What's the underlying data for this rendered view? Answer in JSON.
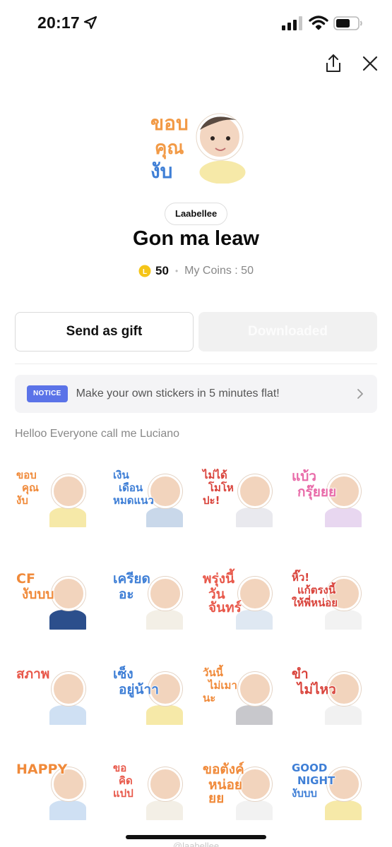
{
  "status_bar": {
    "time": "20:17",
    "icons": [
      "location-arrow-icon",
      "signal-icon",
      "wifi-icon",
      "battery-icon"
    ]
  },
  "top_actions": {
    "icons": [
      "share-icon",
      "close-icon"
    ]
  },
  "package": {
    "hero_sticker_text": [
      "ขอบ",
      "คุณ",
      "งับ"
    ],
    "author": "Laabellee",
    "title": "Gon ma leaw",
    "coin_badge": "L",
    "price": "50",
    "my_coins": "My Coins : 50",
    "description": "Helloo Everyone call me Luciano"
  },
  "buttons": {
    "gift": "Send as gift",
    "downloaded": "Downloaded"
  },
  "notice": {
    "badge": "NOTICE",
    "text": "Make your own stickers in 5 minutes flat!"
  },
  "stickers": [
    {
      "text": "ขอบ คุณ งับ",
      "color": "#f08a3a"
    },
    {
      "text": "เงิน เดือน หมดแนว",
      "color": "#3f7fd6"
    },
    {
      "text": "ไม่ได้ โมโห ปะ!",
      "color": "#d9433b"
    },
    {
      "text": "แบ้ว กรุ๊ยยย",
      "color": "#e86aa8"
    },
    {
      "text": "CF งับบบ",
      "color": "#f08a3a"
    },
    {
      "text": "เครียด อะ",
      "color": "#3f7fd6"
    },
    {
      "text": "พรุ่งนี้ วันจันทร์",
      "color": "#e8584a"
    },
    {
      "text": "หิ๊ว! แก้ตรงนี้ ให้พี่หน่อย",
      "color": "#d9433b"
    },
    {
      "text": "สภาพ",
      "color": "#e8584a"
    },
    {
      "text": "เซ็ง อยู่น้าา",
      "color": "#3f7fd6"
    },
    {
      "text": "วันนี้ ไม่เมา นะ",
      "color": "#f08a3a"
    },
    {
      "text": "ขำ ไม่ไหว",
      "color": "#d9433b"
    },
    {
      "text": "HAPPY",
      "color": "#f08a3a"
    },
    {
      "text": "ขอ คิด แปป",
      "color": "#e8584a"
    },
    {
      "text": "ขอตังค์ หน่อยยย",
      "color": "#f08a3a"
    },
    {
      "text": "GOOD NIGHT งับบบ",
      "color": "#3f7fd6"
    }
  ],
  "footer_peek": "@laabellee"
}
